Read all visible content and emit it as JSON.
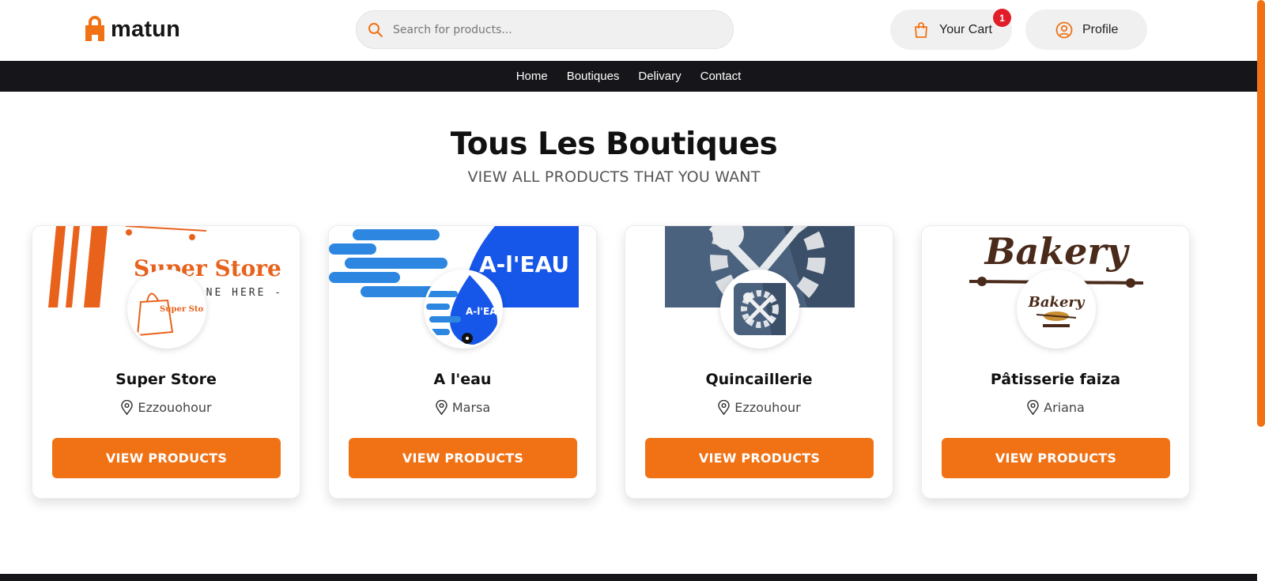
{
  "header": {
    "logo_text": "matun",
    "search_placeholder": "Search for products...",
    "cart_label": "Your Cart",
    "cart_count": "1",
    "profile_label": "Profile"
  },
  "nav": {
    "items": [
      {
        "label": "Home"
      },
      {
        "label": "Boutiques"
      },
      {
        "label": "Delivary"
      },
      {
        "label": "Contact"
      }
    ]
  },
  "section": {
    "title": "Tous Les Boutiques",
    "subtitle": "VIEW ALL PRODUCTS THAT YOU WANT"
  },
  "stores": [
    {
      "name": "Super Store",
      "location": "Ezzouohour",
      "button": "VIEW PRODUCTS",
      "banner_text": "Super Store",
      "banner_tagline": "- NE HERE -",
      "avatar_text": "Super Store"
    },
    {
      "name": "A l'eau",
      "location": "Marsa",
      "button": "VIEW PRODUCTS",
      "banner_text": "A-l'EAU",
      "avatar_text": "A-l'EA"
    },
    {
      "name": "Quincaillerie",
      "location": "Ezzouhour",
      "button": "VIEW PRODUCTS"
    },
    {
      "name": "Pâtisserie faiza",
      "location": "Ariana",
      "button": "VIEW PRODUCTS",
      "banner_text": "Bakery",
      "avatar_text": "Bakery"
    }
  ],
  "colors": {
    "accent": "#f07215",
    "nav_bg": "#16161a",
    "badge": "#e11d2a"
  }
}
